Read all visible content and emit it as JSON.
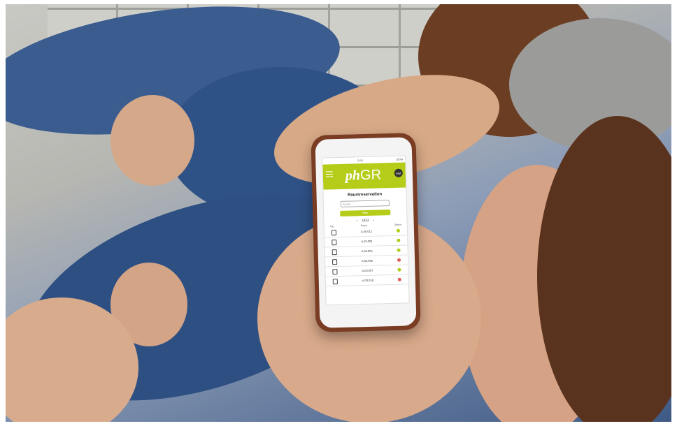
{
  "phone_app": {
    "status_bar": {
      "left": "",
      "center": "9:41",
      "right": "100%"
    },
    "menu_icon": "hamburger-menu-icon",
    "logo": {
      "ph": "ph",
      "gr": "GR"
    },
    "badge": "MM",
    "screen_title": "Raumreservation",
    "search_placeholder": "Suche",
    "filter_button": "Filter",
    "level_nav": {
      "prev": "‹",
      "label": "UG2",
      "next": "›"
    },
    "columns": {
      "type": "Typ",
      "room": "Raum",
      "status": "Status"
    },
    "rooms": [
      {
        "room": "A.00.012",
        "status_color": "#b5cc18"
      },
      {
        "room": "A.03.003",
        "status_color": "#b5cc18"
      },
      {
        "room": "A.03.004",
        "status_color": "#b5cc18"
      },
      {
        "room": "A.03.005",
        "status_color": "#e05a5a"
      },
      {
        "room": "A.03.007",
        "status_color": "#b5cc18"
      },
      {
        "room": "A.03.018",
        "status_color": "#e05a5a"
      }
    ]
  },
  "colors": {
    "accent": "#b5cc18",
    "busy": "#e05a5a",
    "case": "#7a3d24"
  }
}
